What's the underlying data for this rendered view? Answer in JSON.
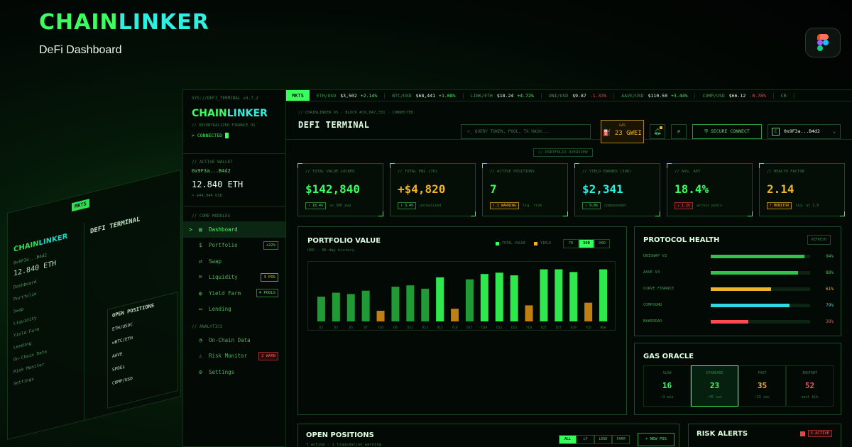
{
  "brand": {
    "part1": "CHAIN",
    "part2": "LINKER",
    "subtitle": "DeFi Dashboard"
  },
  "colors": {
    "green": "#3bff5e",
    "cyan": "#2ff0e0",
    "amber": "#f0b429",
    "red": "#ff4d4d"
  },
  "preview": {
    "mkts": "MKTS",
    "brand1": "CHAIN",
    "brand2": "LINKER",
    "title": "DEFI TERMINAL",
    "wallet": "0x9F3a...B4d2",
    "eth": "12.840 ETH",
    "items": [
      "Dashboard",
      "Portfolio",
      "Swap",
      "Liquidity",
      "Yield Farm",
      "Lending",
      "On-Chain Data",
      "Risk Monitor",
      "Settings"
    ],
    "card_title": "OPEN POSITIONS",
    "card_rows": [
      "ETH/USDC",
      "wBTC/ETH",
      "AAVE",
      "SPDEL",
      "COMP/USD"
    ]
  },
  "sidebar": {
    "path": "SYS://DEFI_TERMINAL v4.7.2",
    "brand1": "CHAIN",
    "brand2": "LINKER",
    "desc": "// DECENTRALIZED FINANCE OS",
    "connected": "> CONNECTED",
    "wallet_label": "// ACTIVE WALLET",
    "wallet_addr": "0x9F3a...B4d2",
    "wallet_eth": "12.840 ETH",
    "wallet_usd": "≈ $44,944 USD",
    "core_label": "// CORE MODULES",
    "analytics_label": "// ANALYTICS",
    "items": [
      {
        "icon": "▦",
        "label": "Dashboard",
        "badge": ""
      },
      {
        "icon": "$",
        "label": "Portfolio",
        "badge": "+22%"
      },
      {
        "icon": "⇄",
        "label": "Swap",
        "badge": ""
      },
      {
        "icon": "⌘",
        "label": "Liquidity",
        "badge": "3 POS"
      },
      {
        "icon": "◍",
        "label": "Yield Farm",
        "badge": "4 POOLS"
      },
      {
        "icon": "▭",
        "label": "Lending",
        "badge": ""
      },
      {
        "icon": "◔",
        "label": "On-Chain Data",
        "badge": ""
      },
      {
        "icon": "⚠",
        "label": "Risk Monitor",
        "badge": "2 WARN"
      },
      {
        "icon": "⚙",
        "label": "Settings",
        "badge": ""
      }
    ]
  },
  "ticker": {
    "mkts": "MKTS",
    "items": [
      {
        "pair": "ETH/USD",
        "price": "$3,502",
        "change": "+2.14%",
        "dir": "up"
      },
      {
        "pair": "BTC/USD",
        "price": "$68,441",
        "change": "+1.08%",
        "dir": "up"
      },
      {
        "pair": "LINK/ETH",
        "price": "$18.24",
        "change": "+4.72%",
        "dir": "up"
      },
      {
        "pair": "UNI/USD",
        "price": "$9.87",
        "change": "-1.33%",
        "dir": "dn"
      },
      {
        "pair": "AAVE/USD",
        "price": "$110.50",
        "change": "+3.44%",
        "dir": "up"
      },
      {
        "pair": "COMP/USD",
        "price": "$66.12",
        "change": "-0.78%",
        "dir": "dn"
      },
      {
        "pair": "CR",
        "price": "",
        "change": "",
        "dir": "up"
      }
    ]
  },
  "header": {
    "path": "// CHAINLINKER OS  ·  BLOCK #19,847,331  ·  CONNECTED",
    "title": "DEFI TERMINAL",
    "search_placeholder": ">_ QUERY TOKEN, POOL, TX HASH...",
    "gas_label": "GAS",
    "gas_value": "23 GWEI",
    "secure": "SECURE CONNECT",
    "wallet": "0x9F3a...B4d2",
    "wallet_icon": "C"
  },
  "overview_label": "// PORTFOLIO OVERVIEW",
  "stats": [
    {
      "label": "// TOTAL VALUE LOCKED",
      "value": "$142,840",
      "color": "#3bff5e",
      "chip": "↑ 18.4%",
      "chip_type": "green",
      "note": "vs 30D avg"
    },
    {
      "label": "// TOTAL PNL (7D)",
      "value": "+$4,820",
      "color": "#f0b429",
      "chip": "↑ 3.4%",
      "chip_type": "green",
      "note": "unrealized"
    },
    {
      "label": "// ACTIVE POSITIONS",
      "value": "7",
      "color": "#3bff5e",
      "chip": "! 1 WARNING",
      "chip_type": "amber",
      "note": "liq. risk"
    },
    {
      "label": "// YIELD EARNED (30D)",
      "value": "$2,341",
      "color": "#2ff0e0",
      "chip": "↑ 9.8%",
      "chip_type": "green",
      "note": "compounded"
    },
    {
      "label": "// AVG. APY",
      "value": "18.4%",
      "color": "#3bff5e",
      "chip": "↓ 1.2%",
      "chip_type": "red",
      "note": "across pools"
    },
    {
      "label": "// HEALTH FACTOR",
      "value": "2.14",
      "color": "#f0b429",
      "chip": "! MONITOR",
      "chip_type": "amber",
      "note": "liq. at 1.0"
    }
  ],
  "portfolio": {
    "title": "PORTFOLIO VALUE",
    "subtitle": "USD · 30-day history",
    "legend_total": "TOTAL VALUE",
    "legend_yield": "YIELD",
    "ranges": [
      "7D",
      "30D",
      "90D"
    ],
    "active_range": "30D"
  },
  "chart_data": {
    "type": "bar",
    "categories": [
      "D1",
      "D3",
      "D5",
      "D7",
      "YLD",
      "D9",
      "D11",
      "D13",
      "D15",
      "YLD",
      "D17",
      "D19",
      "D21",
      "D23",
      "YLD",
      "D25",
      "D27",
      "D29",
      "YLD",
      "NOW"
    ],
    "values": [
      37,
      43,
      41,
      46,
      16,
      52,
      54,
      49,
      66,
      19,
      63,
      71,
      73,
      69,
      24,
      78,
      78,
      74,
      28,
      78
    ],
    "kinds": [
      "total",
      "total",
      "total",
      "total",
      "yield",
      "total",
      "total",
      "total",
      "total",
      "yield",
      "total",
      "total",
      "total",
      "total",
      "yield",
      "total",
      "total",
      "total",
      "yield",
      "total"
    ],
    "ylim": [
      0,
      85
    ],
    "grid": false,
    "legend": "top-right"
  },
  "protocol_health": {
    "title": "PROTOCOL HEALTH",
    "refresh": "REFRESH",
    "rows": [
      {
        "name": "UNISWAP V3",
        "pct": 94,
        "label": "94%",
        "color": "#2fc54a"
      },
      {
        "name": "AAVE V3",
        "pct": 88,
        "label": "88%",
        "color": "#2fc54a"
      },
      {
        "name": "CURVE FINANCE",
        "pct": 61,
        "label": "61%",
        "color": "#f0b429"
      },
      {
        "name": "COMPOUND",
        "pct": 79,
        "label": "79%",
        "color": "#2fd8e0"
      },
      {
        "name": "MAKERDAO",
        "pct": 38,
        "label": "38%",
        "color": "#ff4d4d"
      }
    ]
  },
  "gas_oracle": {
    "title": "GAS ORACLE",
    "cells": [
      {
        "label": "SLOW",
        "value": "16",
        "time": "~3 min",
        "color": "#3bff5e",
        "active": false
      },
      {
        "label": "STANDARD",
        "value": "23",
        "time": "~45 sec",
        "color": "#3bff5e",
        "active": true
      },
      {
        "label": "FAST",
        "value": "35",
        "time": "~15 sec",
        "color": "#f0b429",
        "active": false
      },
      {
        "label": "INSTANT",
        "value": "52",
        "time": "next blk",
        "color": "#ff4d4d",
        "active": false
      }
    ]
  },
  "open_positions": {
    "title": "OPEN POSITIONS",
    "subtitle": "7 active · 1 liquidation warning",
    "filters": [
      "ALL",
      "LP",
      "LEND",
      "FARM"
    ],
    "active_filter": "ALL",
    "new_pos": "+ NEW POS"
  },
  "risk_alerts": {
    "title": "RISK ALERTS",
    "badge": "3 ACTIVE"
  }
}
